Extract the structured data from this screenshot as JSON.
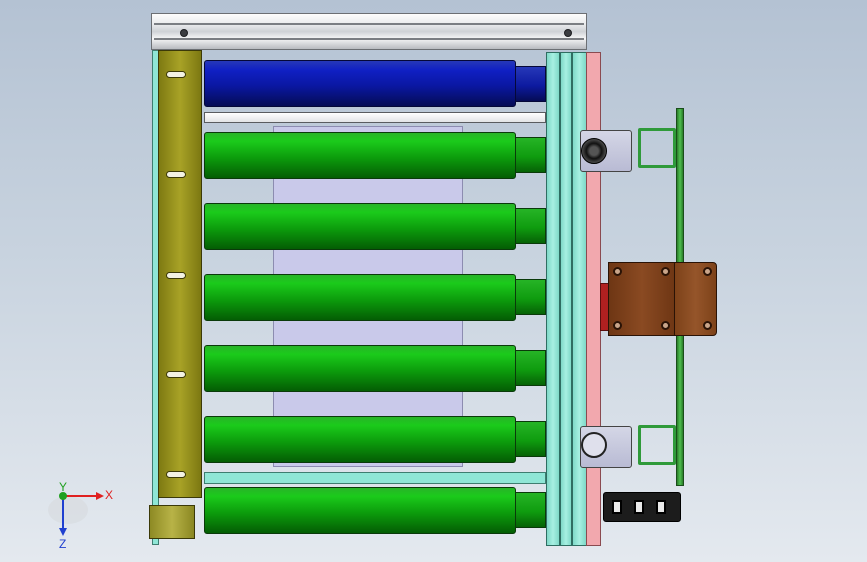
{
  "triad": {
    "x_label": "X",
    "y_label": "Y",
    "z_label": "Z",
    "colors": {
      "x": "#e02020",
      "y": "#20a020",
      "z": "#2040d0"
    }
  },
  "parts": {
    "rollers": [
      {
        "id": "roller-top",
        "color": "blue"
      },
      {
        "id": "roller-1",
        "color": "green"
      },
      {
        "id": "roller-2",
        "color": "green"
      },
      {
        "id": "roller-3",
        "color": "green"
      },
      {
        "id": "roller-4",
        "color": "green"
      },
      {
        "id": "roller-5",
        "color": "green"
      },
      {
        "id": "roller-bottom",
        "color": "green"
      }
    ],
    "colors": {
      "plate": "#a8a226",
      "frame_cyan": "#8fe6d6",
      "frame_pink": "#f2a8ae",
      "motor": "#8a4a22",
      "panel": "#c9c9ea"
    }
  }
}
